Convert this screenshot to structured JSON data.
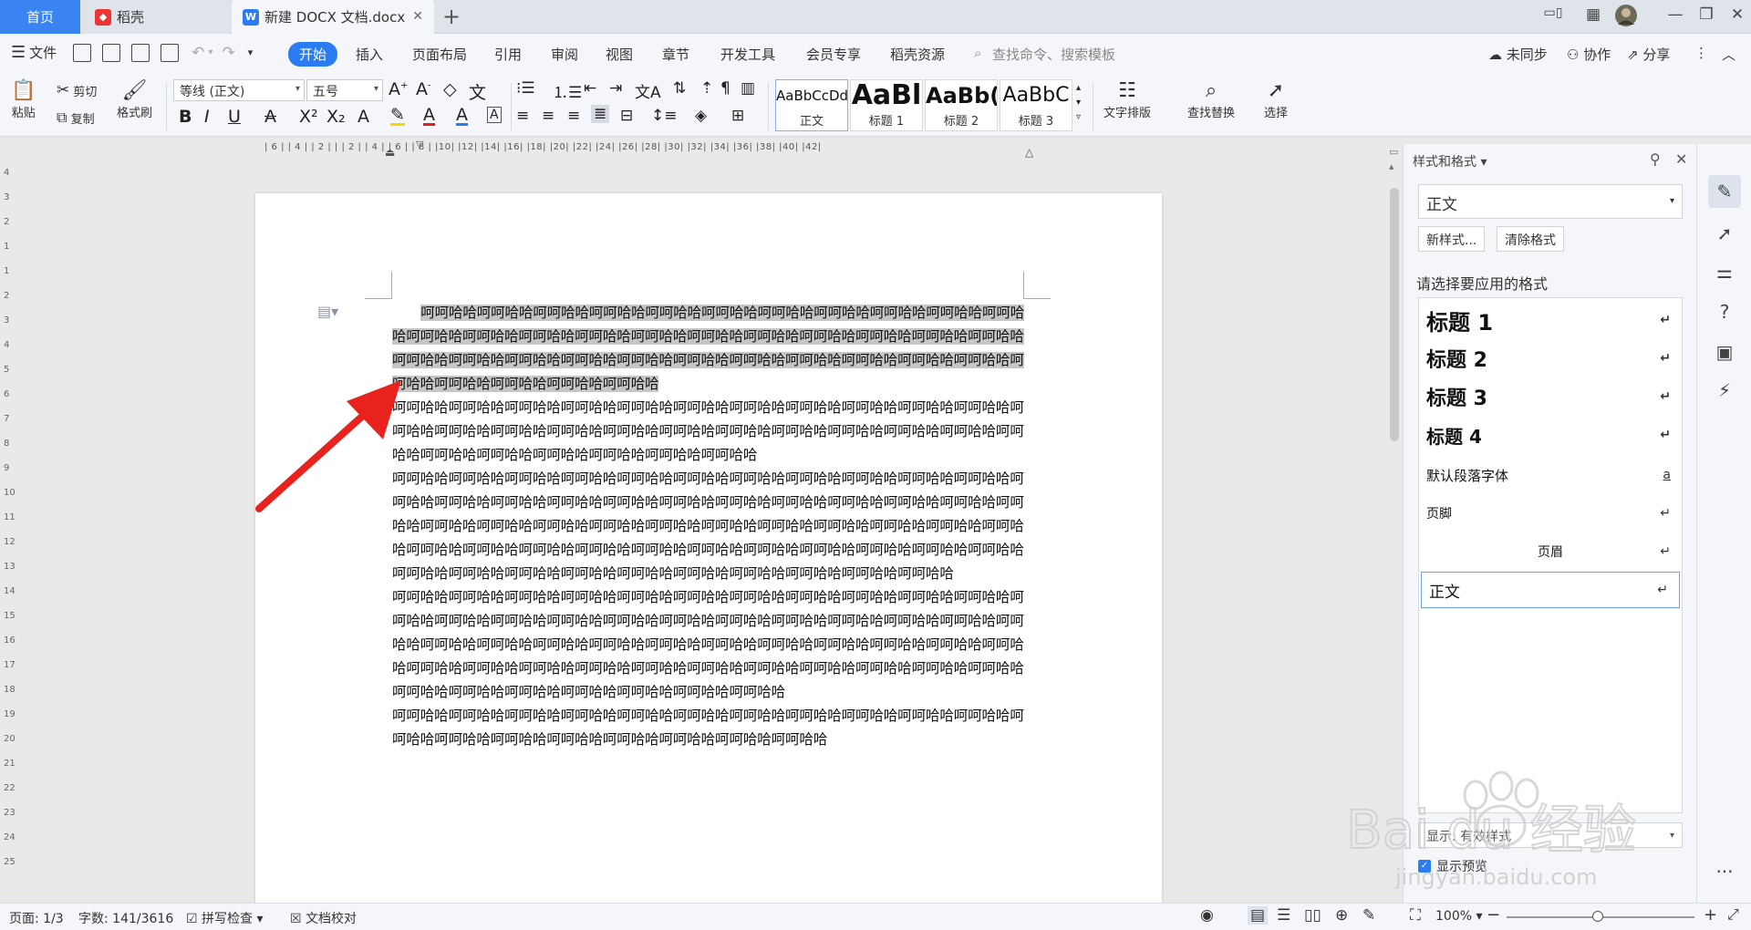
{
  "tabs": {
    "home": "首页",
    "daoke": "稻壳",
    "doc": "新建 DOCX 文档.docx"
  },
  "menu": {
    "file": "文件",
    "tabs": [
      "开始",
      "插入",
      "页面布局",
      "引用",
      "审阅",
      "视图",
      "章节",
      "开发工具",
      "会员专享",
      "稻壳资源"
    ],
    "search_placeholder": "查找命令、搜索模板",
    "sync": "未同步",
    "collab": "协作",
    "share": "分享"
  },
  "ribbon": {
    "paste": "粘贴",
    "cut": "剪切",
    "copy": "复制",
    "format_painter": "格式刷",
    "font_name": "等线 (正文)",
    "font_size": "五号",
    "styles": [
      {
        "preview": "AaBbCcDd",
        "name": "正文"
      },
      {
        "preview": "AaBl",
        "name": "标题 1"
      },
      {
        "preview": "AaBb(",
        "name": "标题 2"
      },
      {
        "preview": "AaBbC",
        "name": "标题 3"
      }
    ],
    "text_layout": "文字排版",
    "find_replace": "查找替换",
    "select": "选择"
  },
  "ruler": {
    "h_ticks": "| 6 |   | 4 |   | 2 |   |   | 2 |   | 4 |   | 6 |   | 8 |   |10|   |12|   |14|   |16|   |18|   |20|   |22|   |24|   |26|   |28|   |30|   |32|   |34|   |36|   |38|   |40|   |42|",
    "v_ticks": [
      "4",
      "3",
      "2",
      "1",
      "1",
      "2",
      "3",
      "4",
      "5",
      "6",
      "7",
      "8",
      "9",
      "10",
      "11",
      "12",
      "13",
      "14",
      "15",
      "16",
      "17",
      "18",
      "19",
      "20",
      "21",
      "22",
      "23",
      "24",
      "25"
    ]
  },
  "document": {
    "paragraphs": [
      {
        "selected": true,
        "text": "呵呵哈哈呵呵哈哈呵呵哈哈呵呵哈哈呵呵哈哈呵呵哈哈呵呵哈哈呵呵哈哈呵呵哈哈呵呵哈哈呵呵哈哈呵呵哈哈呵呵哈哈呵呵哈哈呵呵哈哈呵呵哈哈呵呵哈哈呵呵哈哈呵呵哈哈呵呵哈哈呵呵哈哈呵呵哈哈呵呵哈哈呵呵哈哈呵呵哈哈呵呵哈哈呵呵哈哈呵呵哈哈呵呵哈哈呵呵哈哈呵呵哈哈呵呵哈哈呵呵哈哈呵呵哈哈呵呵哈哈呵呵哈哈呵呵哈哈呵呵哈哈"
      },
      {
        "selected": false,
        "text": "呵呵哈哈呵呵哈哈呵呵哈哈呵呵哈哈呵呵哈哈呵呵哈哈呵呵哈哈呵呵哈哈呵呵哈哈呵呵哈哈呵呵哈哈呵呵哈哈呵呵哈哈呵呵哈哈呵呵哈哈呵呵哈哈呵呵哈哈呵呵哈哈呵呵哈哈呵呵哈哈呵呵哈哈呵呵哈哈呵呵哈哈呵呵哈哈呵呵哈哈呵呵哈哈呵呵哈哈呵呵哈哈呵呵哈哈"
      },
      {
        "selected": false,
        "text": "呵呵哈哈呵呵哈哈呵呵哈哈呵呵哈哈呵呵哈哈呵呵哈哈呵呵哈哈呵呵哈哈呵呵哈哈呵呵哈哈呵呵哈哈呵呵哈哈呵呵哈哈呵呵哈哈呵呵哈哈呵呵哈哈呵呵哈哈呵呵哈哈呵呵哈哈呵呵哈哈呵呵哈哈呵呵哈哈呵呵哈哈呵呵哈哈呵呵哈哈呵呵哈哈呵呵哈哈呵呵哈哈呵呵哈哈呵呵哈哈呵呵哈哈呵呵哈哈呵呵哈哈呵呵哈哈呵呵哈哈呵呵哈哈呵呵哈哈呵呵哈哈呵呵哈哈呵呵哈哈呵呵哈哈呵呵哈哈呵呵哈哈呵呵哈哈呵呵哈哈呵呵哈哈呵呵哈哈呵呵哈哈呵呵哈哈呵呵哈哈呵呵哈哈呵呵哈哈呵呵哈哈呵呵哈哈呵呵哈哈"
      },
      {
        "selected": false,
        "text": "呵呵哈哈呵呵哈哈呵呵哈哈呵呵哈哈呵呵哈哈呵呵哈哈呵呵哈哈呵呵哈哈呵呵哈哈呵呵哈哈呵呵哈哈呵呵哈哈呵呵哈哈呵呵哈哈呵呵哈哈呵呵哈哈呵呵哈哈呵呵哈哈呵呵哈哈呵呵哈哈呵呵哈哈呵呵哈哈呵呵哈哈呵呵哈哈呵呵哈哈呵呵哈哈呵呵哈哈呵呵哈哈呵呵哈哈呵呵哈哈呵呵哈哈呵呵哈哈呵呵哈哈呵呵哈哈呵呵哈哈呵呵哈哈呵呵哈哈呵呵哈哈呵呵哈哈呵呵哈哈呵呵哈哈呵呵哈哈呵呵哈哈呵呵哈哈呵呵哈哈呵呵哈哈呵呵哈哈呵呵哈哈呵呵哈哈呵呵哈哈呵呵哈哈呵呵哈哈"
      },
      {
        "selected": false,
        "text": "呵呵哈哈呵呵哈哈呵呵哈哈呵呵哈哈呵呵哈哈呵呵哈哈呵呵哈哈呵呵哈哈呵呵哈哈呵呵哈哈呵呵哈哈呵呵哈哈呵呵哈哈呵呵哈哈呵呵哈哈呵呵哈哈呵呵哈哈呵呵哈哈呵呵哈哈"
      }
    ]
  },
  "styles_pane": {
    "title": "样式和格式",
    "current_style": "正文",
    "new_style": "新样式...",
    "clear_format": "清除格式",
    "pick_label": "请选择要应用的格式",
    "items": [
      {
        "label": "标题 1",
        "mark": "↵"
      },
      {
        "label": "标题 2",
        "mark": "↵"
      },
      {
        "label": "标题 3",
        "mark": "↵"
      },
      {
        "label": "标题 4",
        "mark": "↵"
      },
      {
        "label": "默认段落字体",
        "mark": "a"
      },
      {
        "label": "页脚",
        "mark": "↵"
      },
      {
        "label": "页眉",
        "mark": "↵"
      },
      {
        "label": "正文",
        "mark": "↵"
      }
    ],
    "show_label": "显示: 有效样式",
    "preview_label": "显示预览"
  },
  "status": {
    "page": "页面: 1/3",
    "words": "字数: 141/3616",
    "spell": "拼写检查",
    "proof": "文档校对",
    "zoom": "100%"
  },
  "watermark": {
    "brand": "Bai du 经验",
    "url": "jingyan.baidu.com"
  },
  "colors": {
    "accent": "#2b7bf3",
    "home_tab": "#3a83f2",
    "selection": "#c6c6c6",
    "arrow": "#e8231e"
  }
}
